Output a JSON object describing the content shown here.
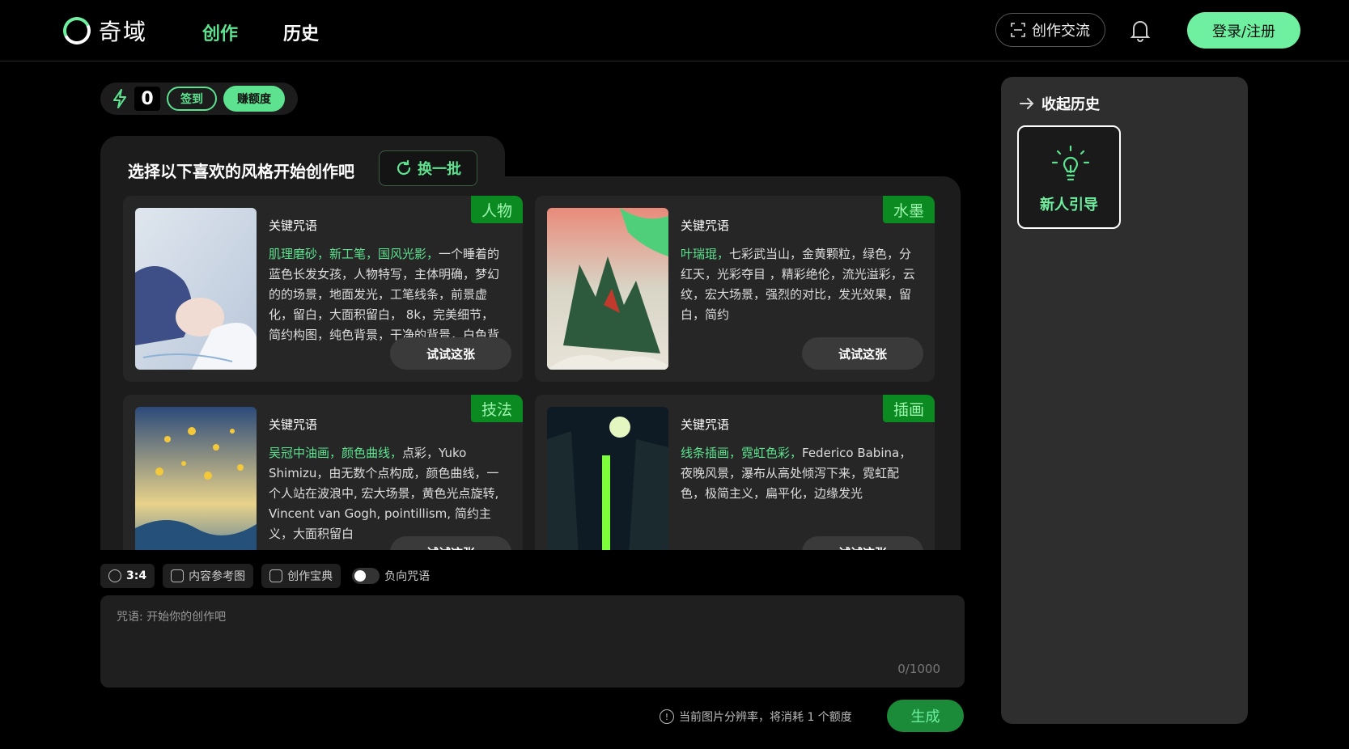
{
  "header": {
    "logo_text": "奇域",
    "nav": [
      "创作",
      "历史"
    ],
    "exchange_label": "创作交流",
    "login_label": "登录/注册"
  },
  "credits": {
    "count": "0",
    "checkin_label": "签到",
    "earn_label": "赚额度"
  },
  "styles": {
    "title": "选择以下喜欢的风格开始创作吧",
    "refresh_label": "换一批",
    "cards": [
      {
        "tag": "人物",
        "label": "关键咒语",
        "highlight": "肌理磨砂，新工笔，国风光影，",
        "desc": "一个睡着的蓝色长发女孩，人物特写，主体明确，梦幻的的场景，地面发光，工笔线条，前景虚化，留白，大面积留白， 8k，完美细节，简约构图，纯色背景，干净的背景，白色背",
        "try_label": "试试这张"
      },
      {
        "tag": "水墨",
        "label": "关键咒语",
        "highlight": "叶瑞琨，",
        "desc": "七彩武当山，金黄颗粒，绿色，分红天，光彩夺目 ，精彩绝伦，流光溢彩，云纹，宏大场景，强烈的对比，发光效果，留白，简约",
        "try_label": "试试这张"
      },
      {
        "tag": "技法",
        "label": "关键咒语",
        "highlight": "吴冠中油画，颜色曲线，",
        "desc": "点彩，Yuko Shimizu，由无数个点构成，颜色曲线，一个人站在波浪中, 宏大场景，黄色光点旋转, Vincent van Gogh, pointillism, 简约主义，大面积留白",
        "try_label": "试试这张"
      },
      {
        "tag": "插画",
        "label": "关键咒语",
        "highlight": "线条插画，霓虹色彩，",
        "desc": "Federico Babina，夜晚风景，瀑布从高处倾泻下来，霓虹配色，极简主义，扁平化，边缘发光",
        "try_label": "试试这张"
      }
    ]
  },
  "toolbar": {
    "ratio": "3:4",
    "reference": "内容参考图",
    "codex": "创作宝典",
    "negative": "负向咒语"
  },
  "prompt": {
    "placeholder": "咒语: 开始你的创作吧",
    "count": "0/1000"
  },
  "footer": {
    "cost_note": "当前图片分辨率，将消耗 1 个额度",
    "generate_label": "生成"
  },
  "history": {
    "collapse_label": "收起历史",
    "guide_label": "新人引导"
  },
  "colors": {
    "accent": "#5de38f",
    "tag_bg": "#0a8a20",
    "background": "#000000",
    "panel": "#1c1c1c"
  }
}
